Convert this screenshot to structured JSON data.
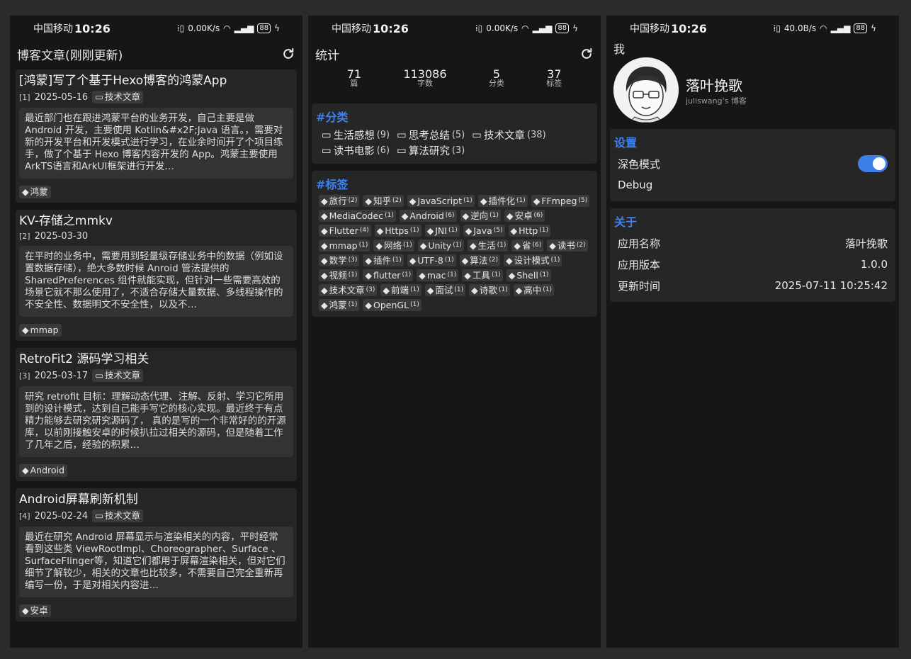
{
  "status": [
    {
      "carrier": "中国移动",
      "time": "10:26",
      "speed": "0.00K/s",
      "battery": "88"
    },
    {
      "carrier": "中国移动",
      "time": "10:26",
      "speed": "0.00K/s",
      "battery": "88"
    },
    {
      "carrier": "中国移动",
      "time": "10:26",
      "speed": "40.0B/s",
      "battery": "88"
    }
  ],
  "posts_screen": {
    "title": "博客文章(刚刚更新)",
    "posts": [
      {
        "title": "[鸿蒙]写了个基于Hexo博客的鸿蒙App",
        "index": "[1]",
        "date": "2025-05-16",
        "category": "技术文章",
        "excerpt": "最近部门也在跟进鸿蒙平台的业务开发，自己主要是做 Android 开发，主要使用 Kotlin&#x2F;Java 语言。，需要对新的开发平台和开发模式进行学习，在业余时间开了个项目练手，做了个基于 Hexo 博客内容开发的 App。鸿蒙主要使用ArkTS语言和ArkUI框架进行开发…",
        "tag": "鸿蒙"
      },
      {
        "title": "KV-存储之mmkv",
        "index": "[2]",
        "date": "2025-03-30",
        "category": "",
        "excerpt": "在平时的业务中，需要用到轻量级存储业务中的数据（例如设置数据存储），绝大多数时候 Anroid 管法提供的 SharedPreferences 组件就能实现，但针对一些需要高效的场景它就不那么使用了，不适合存储大量数据、多线程操作的不安全性、数据明文不安全性，以及不…",
        "tag": "mmap"
      },
      {
        "title": "RetroFit2 源码学习相关",
        "index": "[3]",
        "date": "2025-03-17",
        "category": "技术文章",
        "excerpt": "研究 retrofit 目标：理解动态代理、注解、反射、学习它所用到的设计模式，达到自己能手写它的核心实现。最近终于有点精力能够去研究研究源码了， 真的是写的一个非常好的的开源库，以前刚接触安卓的时候扒拉过相关的源码，但是随着工作了几年之后，经验的积累…",
        "tag": "Android"
      },
      {
        "title": "Android屏幕刷新机制",
        "index": "[4]",
        "date": "2025-02-24",
        "category": "技术文章",
        "excerpt": "最近在研究 Android 屏幕显示与渲染相关的内容，平时经常看到这些类 ViewRootImpl、Choreographer、Surface 、 SurfaceFlinger等，知道它们都用于屏幕渲染相关，但对它们细节了解较少，相关的文章也比较多，不需要自己完全重新再编写一份，于是对相关内容进…",
        "tag": "安卓"
      }
    ]
  },
  "stats_screen": {
    "title": "统计",
    "stats": [
      {
        "value": "71",
        "label": "篇"
      },
      {
        "value": "113086",
        "label": "字数"
      },
      {
        "value": "5",
        "label": "分类"
      },
      {
        "value": "37",
        "label": "标签"
      }
    ],
    "categories_header": "#分类",
    "categories": [
      {
        "name": "生活感想",
        "count": "(9)"
      },
      {
        "name": "思考总结",
        "count": "(5)"
      },
      {
        "name": "技术文章",
        "count": "(38)"
      },
      {
        "name": "读书电影",
        "count": "(6)"
      },
      {
        "name": "算法研究",
        "count": "(3)"
      }
    ],
    "tags_header": "#标签",
    "tags": [
      {
        "name": "旅行",
        "count": "(2)"
      },
      {
        "name": "知乎",
        "count": "(2)"
      },
      {
        "name": "JavaScript",
        "count": "(1)"
      },
      {
        "name": "插件化",
        "count": "(1)"
      },
      {
        "name": "FFmpeg",
        "count": "(5)"
      },
      {
        "name": "MediaCodec",
        "count": "(1)"
      },
      {
        "name": "Android",
        "count": "(6)"
      },
      {
        "name": "逆向",
        "count": "(1)"
      },
      {
        "name": "安卓",
        "count": "(6)"
      },
      {
        "name": "Flutter",
        "count": "(4)"
      },
      {
        "name": "Https",
        "count": "(1)"
      },
      {
        "name": "JNI",
        "count": "(1)"
      },
      {
        "name": "Java",
        "count": "(5)"
      },
      {
        "name": "Http",
        "count": "(1)"
      },
      {
        "name": "mmap",
        "count": "(1)"
      },
      {
        "name": "网络",
        "count": "(1)"
      },
      {
        "name": "Unity",
        "count": "(1)"
      },
      {
        "name": "生活",
        "count": "(1)"
      },
      {
        "name": "省",
        "count": "(6)"
      },
      {
        "name": "读书",
        "count": "(2)"
      },
      {
        "name": "数学",
        "count": "(3)"
      },
      {
        "name": "插件",
        "count": "(1)"
      },
      {
        "name": "UTF-8",
        "count": "(1)"
      },
      {
        "name": "算法",
        "count": "(2)"
      },
      {
        "name": "设计模式",
        "count": "(1)"
      },
      {
        "name": "视频",
        "count": "(1)"
      },
      {
        "name": "flutter",
        "count": "(1)"
      },
      {
        "name": "mac",
        "count": "(1)"
      },
      {
        "name": "工具",
        "count": "(1)"
      },
      {
        "name": "Shell",
        "count": "(1)"
      },
      {
        "name": "技术文章",
        "count": "(3)"
      },
      {
        "name": "前端",
        "count": "(1)"
      },
      {
        "name": "面试",
        "count": "(1)"
      },
      {
        "name": "诗歌",
        "count": "(1)"
      },
      {
        "name": "高中",
        "count": "(1)"
      },
      {
        "name": "鸿蒙",
        "count": "(1)"
      },
      {
        "name": "OpenGL",
        "count": "(1)"
      }
    ]
  },
  "me_screen": {
    "title": "我",
    "name": "落叶挽歌",
    "subtitle": "juliswang's 博客",
    "settings_header": "设置",
    "dark_mode_label": "深色模式",
    "dark_mode_on": true,
    "debug_label": "Debug",
    "about_header": "关于",
    "about": [
      {
        "label": "应用名称",
        "value": "落叶挽歌"
      },
      {
        "label": "应用版本",
        "value": "1.0.0"
      },
      {
        "label": "更新时间",
        "value": "2025-07-11 10:25:42"
      }
    ]
  },
  "colors": {
    "accent": "#3d82f2",
    "card": "#262626",
    "background": "#161616"
  }
}
